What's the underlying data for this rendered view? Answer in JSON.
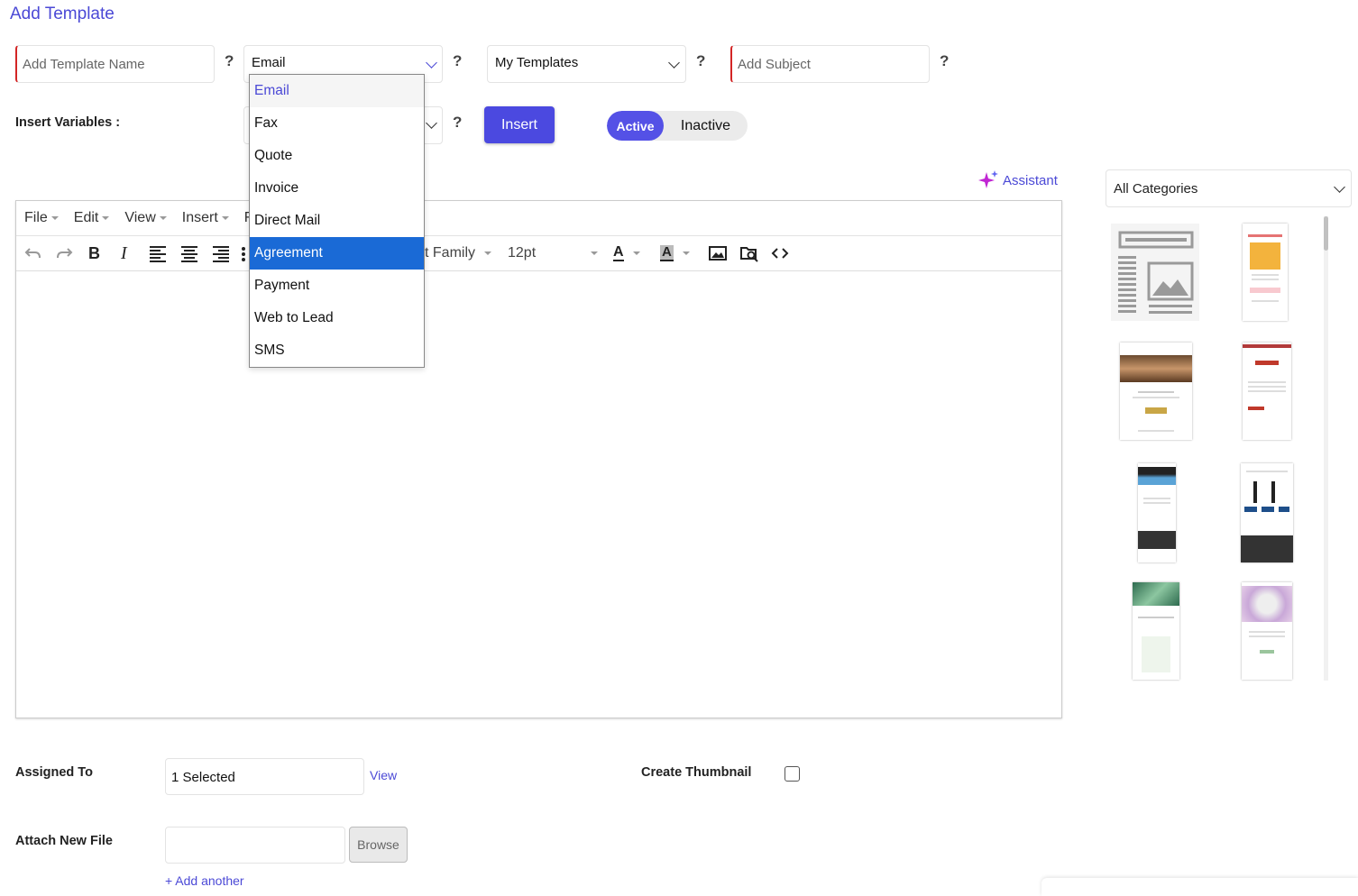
{
  "page": {
    "title": "Add Template"
  },
  "form": {
    "template_name_placeholder": "Add Template Name",
    "type_value": "Email",
    "source_value": "My Templates",
    "subject_placeholder": "Add Subject",
    "help_symbol": "?",
    "insert_variables_label": "Insert Variables :",
    "insert_button": "Insert",
    "status": {
      "active": "Active",
      "inactive": "Inactive"
    },
    "assistant_label": "Assistant"
  },
  "type_dropdown": {
    "options": [
      "Email",
      "Fax",
      "Quote",
      "Invoice",
      "Direct Mail",
      "Agreement",
      "Payment",
      "Web to Lead",
      "SMS"
    ],
    "highlighted": "Agreement"
  },
  "editor": {
    "menus": [
      "File",
      "Edit",
      "View",
      "Insert",
      "F"
    ],
    "font_family_partial": "t Family",
    "font_size": "12pt",
    "toolbar_icons": [
      "undo-icon",
      "redo-icon",
      "bold-icon",
      "italic-icon",
      "align-left-icon",
      "align-center-icon",
      "align-right-icon",
      "more-icon",
      "font-color-icon",
      "background-color-icon",
      "image-icon",
      "media-search-icon",
      "source-code-icon"
    ]
  },
  "categories": {
    "selected": "All Categories"
  },
  "bottom": {
    "assigned_to_label": "Assigned To",
    "assigned_to_value": "1 Selected",
    "view_link": "View",
    "create_thumbnail_label": "Create Thumbnail",
    "attach_file_label": "Attach New File",
    "browse_button": "Browse",
    "add_another_link": "+ Add another"
  },
  "colors": {
    "accent": "#4b49d6",
    "required": "#d32626",
    "selected_option": "#1a6ad6"
  }
}
